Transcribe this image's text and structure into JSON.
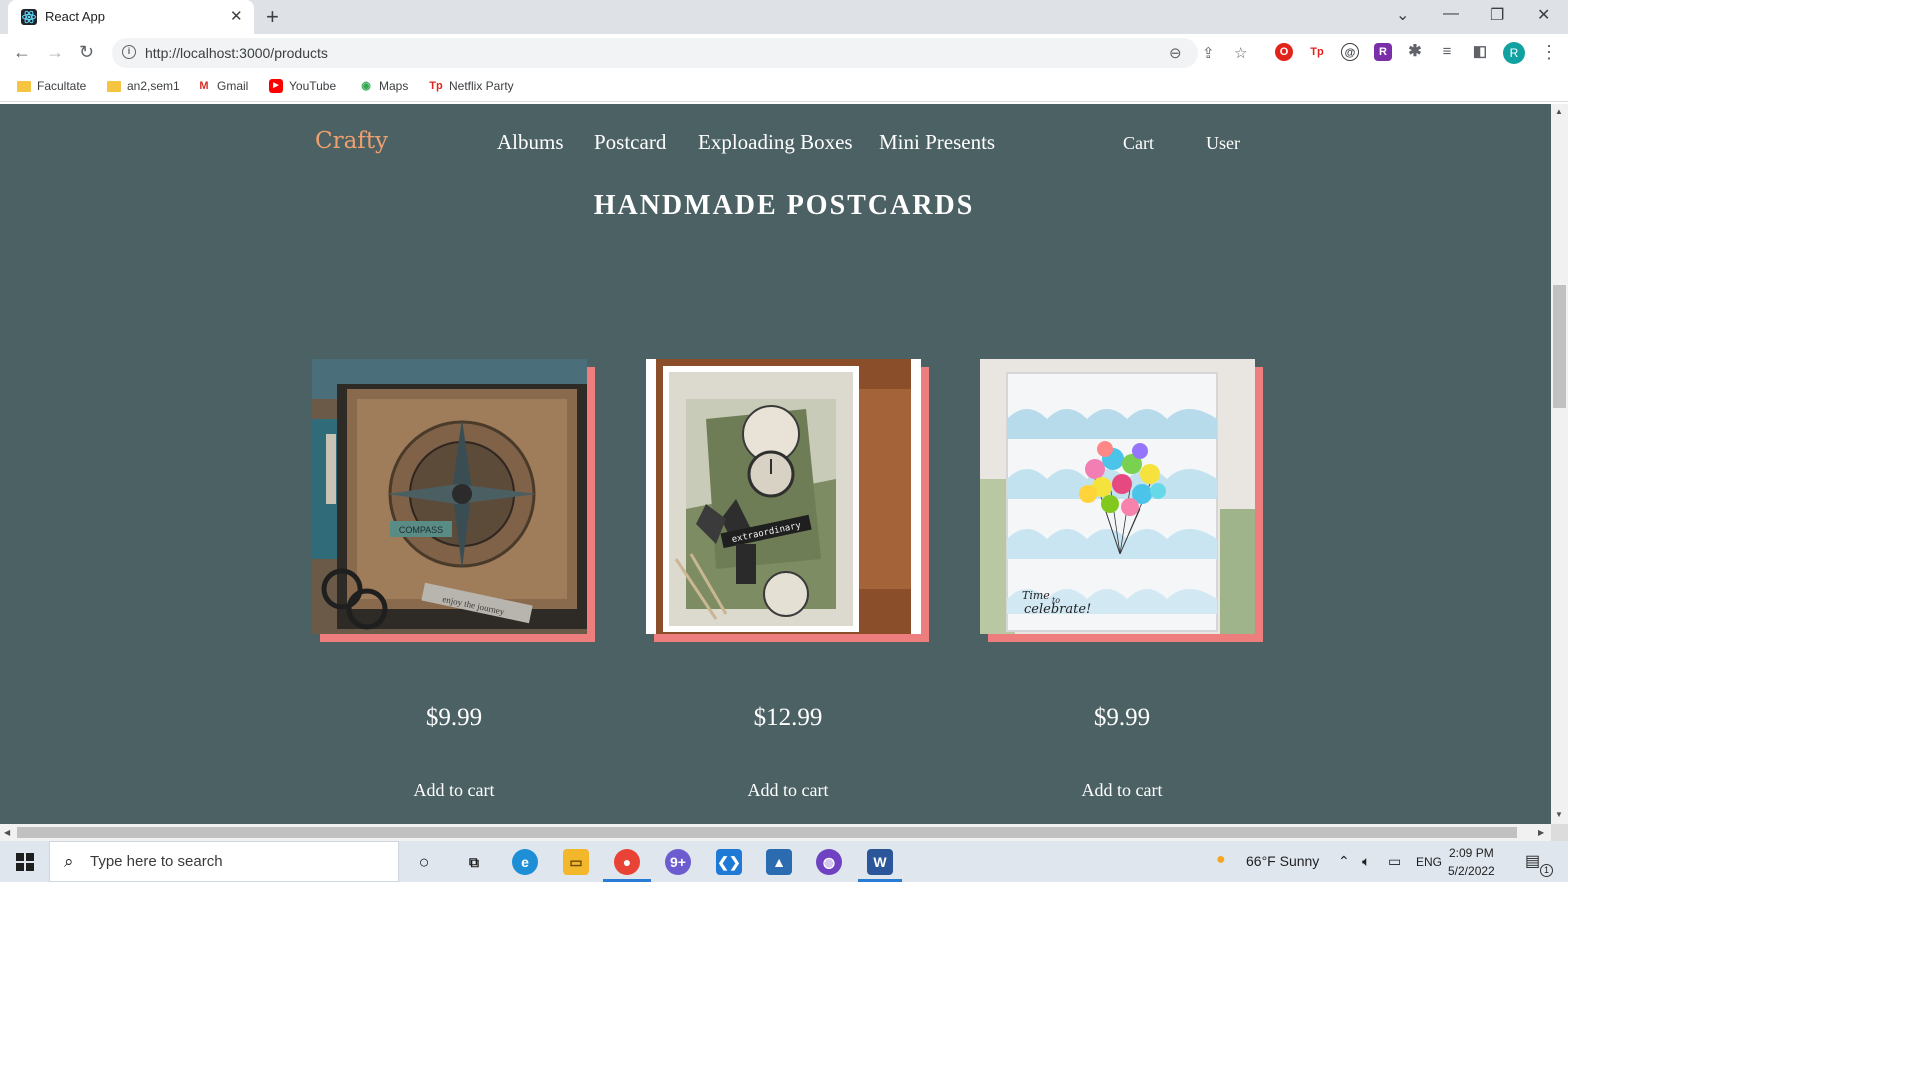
{
  "browser": {
    "tab_title": "React App",
    "tab_close": "✕",
    "new_tab": "+",
    "url": "http://localhost:3000/products",
    "profile_initial": "R",
    "bookmarks": [
      {
        "label": "Facultate",
        "icon": "folder-icon"
      },
      {
        "label": "an2,sem1",
        "icon": "folder-icon"
      },
      {
        "label": "Gmail",
        "icon": "gmail-icon"
      },
      {
        "label": "YouTube",
        "icon": "youtube-icon"
      },
      {
        "label": "Maps",
        "icon": "maps-icon"
      },
      {
        "label": "Netflix Party",
        "icon": "netflix-party-icon"
      }
    ]
  },
  "site": {
    "logo": "Crafty",
    "nav": [
      "Albums",
      "Postcard",
      "Exploading Boxes",
      "Mini Presents"
    ],
    "cart": "Cart",
    "user": "User",
    "title": "HANDMADE POSTCARDS",
    "accent_color": "#ee7d7d",
    "background_color": "#4c6164",
    "products": [
      {
        "image": "compass-postcard",
        "image_text": [
          "COMPASS",
          "enjoy the journey"
        ],
        "price": "$9.99",
        "button": "Add to cart"
      },
      {
        "image": "clock-postcard",
        "image_text": [
          "extraordinary"
        ],
        "price": "$12.99",
        "button": "Add to cart"
      },
      {
        "image": "balloons-postcard",
        "image_text": [
          "Time",
          "to",
          "celebrate!"
        ],
        "price": "$9.99",
        "button": "Add to cart"
      }
    ]
  },
  "taskbar": {
    "search_placeholder": "Type here to search",
    "weather": "66°F  Sunny",
    "language": "ENG",
    "time": "2:09 PM",
    "date": "5/2/2022",
    "notification_count": "1"
  }
}
